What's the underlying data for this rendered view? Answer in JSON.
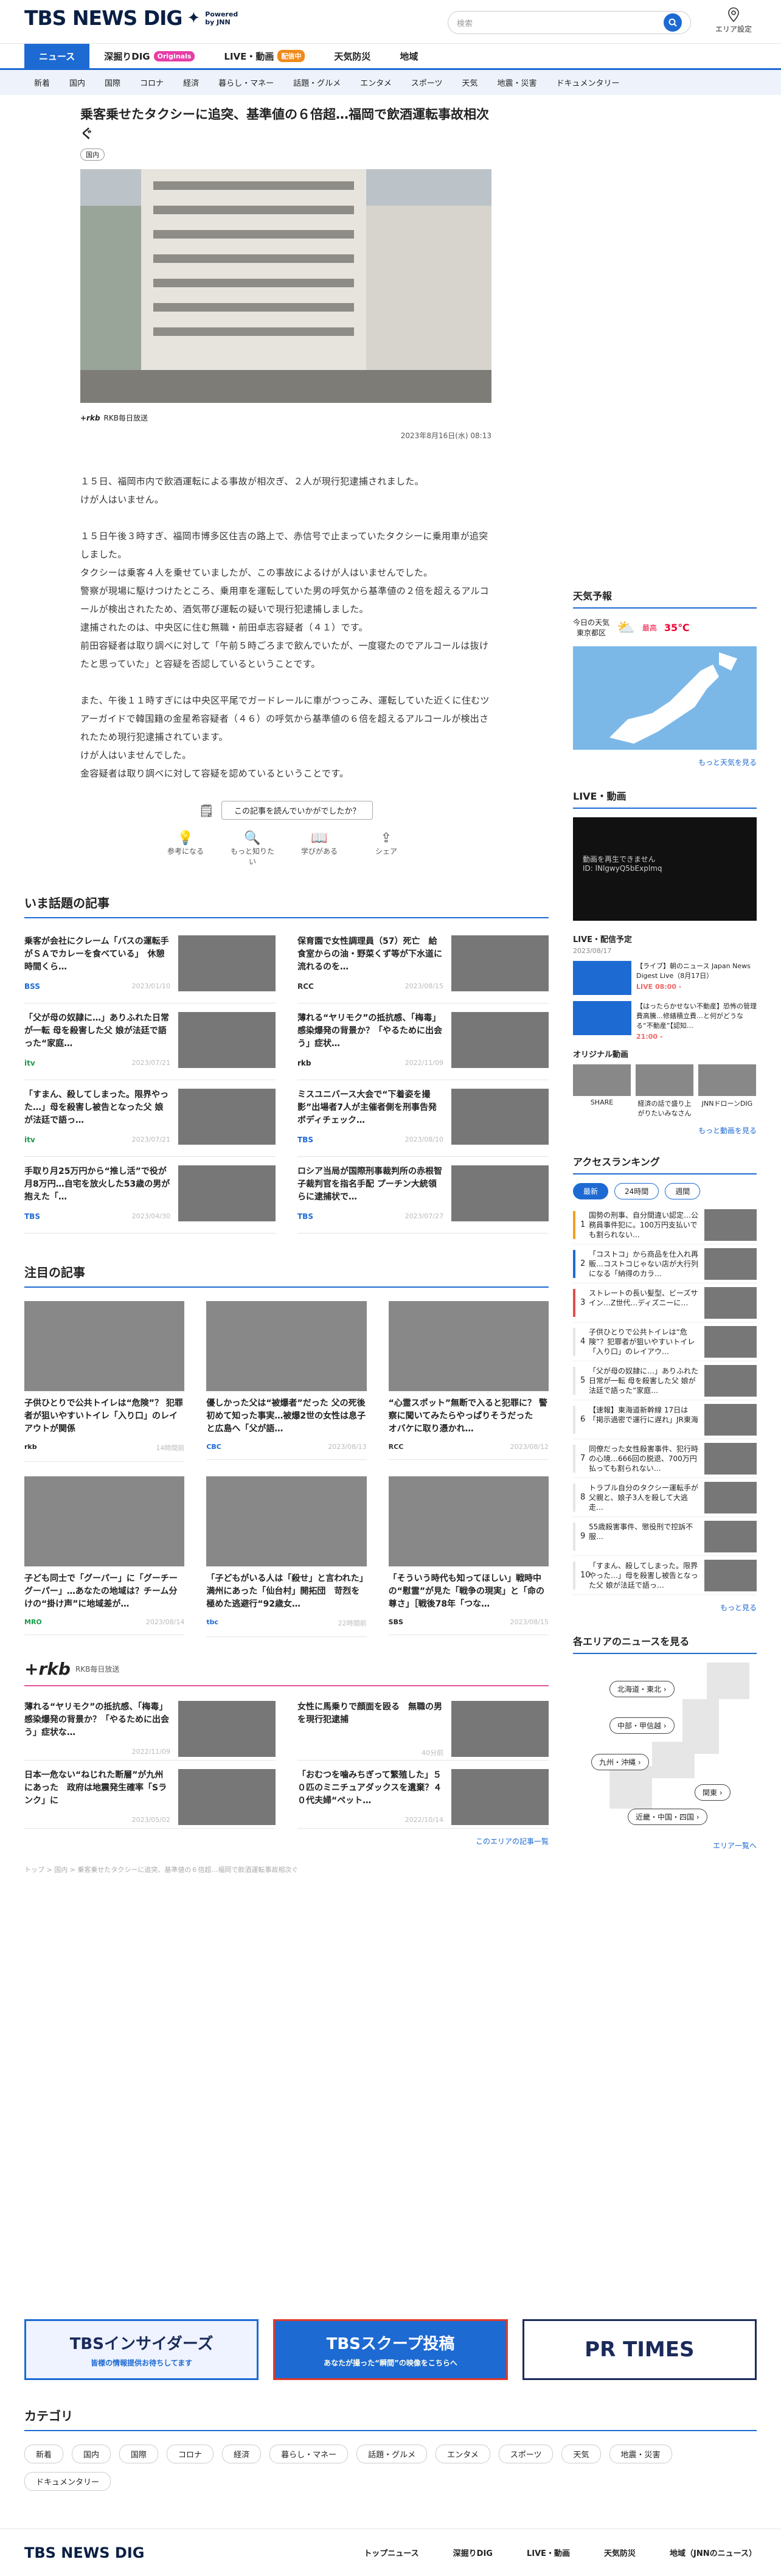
{
  "header": {
    "logo": "TBS NEWS DIG",
    "powered": "Powered\nby JNN",
    "search_placeholder": "検索",
    "area_label": "エリア設定"
  },
  "tabs": [
    {
      "label": "ニュース",
      "active": true
    },
    {
      "label": "深掘りDIG",
      "badge": "Originals",
      "badge_color": "#e63da6"
    },
    {
      "label": "LIVE・動画",
      "badge": "配信中",
      "badge_color": "#f08a1c"
    },
    {
      "label": "天気防災"
    },
    {
      "label": "地域"
    }
  ],
  "categories": [
    "新着",
    "国内",
    "国際",
    "コロナ",
    "経済",
    "暮らし・マネー",
    "話題・グルメ",
    "エンタメ",
    "スポーツ",
    "天気",
    "地震・災害",
    "ドキュメンタリー"
  ],
  "article": {
    "title": "乗客乗せたタクシーに追突、基準値の６倍超…福岡で飲酒運転事故相次ぐ",
    "tag": "国内",
    "source": "RKB毎日放送",
    "date": "2023年8月16日(水) 08:13",
    "paragraphs": [
      "１５日、福岡市内で飲酒運転による事故が相次ぎ、２人が現行犯逮捕されました。\nけが人はいません。",
      "１５日午後３時すぎ、福岡市博多区住吉の路上で、赤信号で止まっていたタクシーに乗用車が追突しました。\nタクシーは乗客４人を乗せていましたが、この事故によるけが人はいませんでした。\n警察が現場に駆けつけたところ、乗用車を運転していた男の呼気から基準値の２倍を超えるアルコールが検出されたため、酒気帯び運転の疑いで現行犯逮捕しました。\n逮捕されたのは、中央区に住む無職・前田卓志容疑者（４１）です。\n前田容疑者は取り調べに対して「午前５時ごろまで飲んでいたが、一度寝たのでアルコールは抜けたと思っていた」と容疑を否認しているということです。",
      "また、午後１１時すぎには中央区平尾でガードレールに車がつっこみ、運転していた近くに住むツアーガイドで韓国籍の金星希容疑者（４６）の呼気から基準値の６倍を超えるアルコールが検出されたため現行犯逮捕されています。\nけが人はいませんでした。\n金容疑者は取り調べに対して容疑を認めているということです。"
    ],
    "ask": "この記事を読んでいかがでしたか？",
    "reactions": [
      "参考になる",
      "もっと知りたい",
      "学びがある",
      "シェア"
    ]
  },
  "trending": {
    "title": "いま話題の記事",
    "items": [
      {
        "title": "乗客が会社にクレーム「バスの運転手がＳＡでカレーを食べている」　休憩時間くら…",
        "brand": "BSS",
        "date": "2023/01/10"
      },
      {
        "title": "保育園で女性調理員（57）死亡　給食室からの油・野菜くず等が下水道に流れるのを…",
        "brand": "RCC",
        "date": "2023/08/15"
      },
      {
        "title": "「父が母の奴隷に…」ありふれた日常が一転 母を殺害した父 娘が法廷で語った“家庭…",
        "brand": "itv",
        "date": "2023/07/21"
      },
      {
        "title": "薄れる“ヤリモク”の抵抗感、「梅毒」感染爆発の背景か？「やるために出会う」症状…",
        "brand": "rkb",
        "date": "2022/11/09"
      },
      {
        "title": "「すまん、殺してしまった。限界やった…」母を殺害し被告となった父 娘が法廷で語っ…",
        "brand": "itv",
        "date": "2023/07/21"
      },
      {
        "title": "ミスユニバース大会で“下着姿を撮影”出場者7人が主催者側を刑事告発 ボディチェック…",
        "brand": "TBS",
        "date": "2023/08/10"
      },
      {
        "title": "手取り月25万円から“推し活”で役が月8万円…自宅を放火した53歳の男が抱えた「…",
        "brand": "TBS",
        "date": "2023/04/30"
      },
      {
        "title": "ロシア当局が国際刑事裁判所の赤根智子裁判官を指名手配 プーチン大統領らに逮捕状で…",
        "brand": "TBS",
        "date": "2023/07/27"
      }
    ]
  },
  "featured": {
    "title": "注目の記事",
    "items": [
      {
        "title": "子供ひとりで公共トイレは“危険”？ 犯罪者が狙いやすいトイレ「入り口」のレイアウトが関係",
        "brand": "rkb",
        "date": "14時間前"
      },
      {
        "title": "優しかった父は“被爆者”だった 父の死後 初めて知った事実…被爆2世の女性は息子と広島へ「父が語…",
        "brand": "CBC",
        "date": "2023/08/13"
      },
      {
        "title": "“心霊スポット”無断で入ると犯罪に？ 警察に聞いてみたらやっぱりそうだった　オバケに取り憑かれ…",
        "brand": "RCC",
        "date": "2023/08/12"
      },
      {
        "title": "子ども同士で「グーパー」に「グーチーグーパー」…あなたの地域は？チーム分けの“掛け声”に地域差が…",
        "brand": "MRO",
        "date": "2023/08/14"
      },
      {
        "title": "「子どもがいる人は「殺せ」と言われた」満州にあった「仙台村」開拓団　苛烈を極めた逃避行“92歳女…",
        "brand": "tbc",
        "date": "22時間前"
      },
      {
        "title": "「そういう時代も知ってほしい」戦時中の“慰霊”が見た「戦争の現実」と「命の尊さ」［戦後78年「つな…",
        "brand": "SBS",
        "date": "2023/08/15"
      }
    ]
  },
  "rkb": {
    "label": "RKB毎日放送",
    "items": [
      {
        "title": "薄れる“ヤリモク”の抵抗感、「梅毒」感染爆発の背景か？「やるために出会う」症状な…",
        "date": "2022/11/09"
      },
      {
        "title": "女性に馬乗りで顔面を殴る　無職の男を現行犯逮捕",
        "date": "40分前"
      },
      {
        "title": "日本一危ない“ねじれた断層”が九州にあった　政府は地震発生確率「Sランク」に",
        "date": "2023/05/02"
      },
      {
        "title": "「おむつを噛みちぎって繁殖した」５０匹のミニチュアダックスを遺棄？４０代夫婦“ペット…",
        "date": "2022/10/14"
      }
    ],
    "more": "このエリアの記事一覧"
  },
  "breadcrumb": "トップ > 国内 > 乗客乗せたタクシーに追突、基準値の６倍超…福岡で飲酒運転事故相次ぐ",
  "sidebar": {
    "weather": {
      "title": "天気予報",
      "today": "今日の天気\n東京都区",
      "label": "最高",
      "temp": "35℃",
      "more": "もっと天気を見る"
    },
    "live": {
      "title": "LIVE・動画",
      "player_error": "動画を再生できません\nID: lNlgwyQ5bExplmq\n",
      "schedule_title": "LIVE・配信予定",
      "schedule_date": "2023/08/17",
      "schedule": [
        {
          "title": "【ライブ】朝のニュース Japan News Digest Live（8月17日）",
          "time": "08:00 -",
          "badge": "LIVE"
        },
        {
          "title": "【はったらかせない不動産】恐怖の管理費高騰…修繕積立費…と何がどうなる“不動産”【認知…",
          "time": "21:00 -"
        }
      ],
      "originals_title": "オリジナル動画",
      "originals": [
        "SHARE",
        "経済の話で盛り上がりたいみなさん",
        "JNNドローンDIG"
      ],
      "more": "もっと動画を見る"
    },
    "ranking": {
      "title": "アクセスランキング",
      "tabs": [
        "最新",
        "24時間",
        "週間"
      ],
      "items": [
        {
          "n": "1",
          "title": "国勢の刑事、自分間違い認定…公務員事件犯に。100万円支払いでも割られない…"
        },
        {
          "n": "2",
          "title": "「コストコ」から商品を仕入れ再販…コストコじゃない店が大行列になる「納得のカラ…"
        },
        {
          "n": "3",
          "title": "ストレートの長い髪型、ビーズサイン…Z世代…ディズニーに…"
        },
        {
          "n": "4",
          "title": "子供ひとりで公共トイレは“危険”？犯罪者が狙いやすいトイレ「入り口」のレイアウ…"
        },
        {
          "n": "5",
          "title": "「父が母の奴隷に…」ありふれた日常が一転 母を殺害した父 娘が法廷で語った“家庭…"
        },
        {
          "n": "6",
          "title": "【速報】東海道新幹線 17日は「掲示過密で運行に遅れ」JR東海"
        },
        {
          "n": "7",
          "title": "同僚だった女性殺害事件、犯行時の心境…666回の脱退、700万円払っても割られない…"
        },
        {
          "n": "8",
          "title": "トラブル自分のタクシー運転手が父親と、娘子3人を殺して大逃走…"
        },
        {
          "n": "9",
          "title": "55歳殺害事件、懲役刑で控訴不服…"
        },
        {
          "n": "10",
          "title": "「すまん、殺してしまった。限界やった…」母を殺害し被告となった父 娘が法廷で語っ…"
        }
      ],
      "more": "もっと見る"
    },
    "areas": {
      "title": "各エリアのニュースを見る",
      "buttons": [
        "北海道・東北",
        "中部・甲信越",
        "九州・沖縄",
        "関東",
        "近畿・中国・四国"
      ],
      "more": "エリア一覧へ"
    }
  },
  "banners": [
    {
      "label": "TBSインサイダーズ",
      "sub": "皆様の情報提供お待ちしてます"
    },
    {
      "label": "TBSスクープ投稿",
      "sub": "あなたが撮った“瞬間”の映像をこちらへ"
    },
    {
      "label": "PR TIMES"
    }
  ],
  "footer_cats": {
    "title": "カテゴリ",
    "items": [
      "新着",
      "国内",
      "国際",
      "コロナ",
      "経済",
      "暮らし・マネー",
      "話題・グルメ",
      "エンタメ",
      "スポーツ",
      "天気",
      "地震・災害",
      "ドキュメンタリー"
    ]
  },
  "footer_nav": [
    "トップニュース",
    "深掘りDIG",
    "LIVE・動画",
    "天気防災",
    "地域（JNNのニュース）"
  ],
  "colors": {
    "accent": "#1d6ad3"
  }
}
